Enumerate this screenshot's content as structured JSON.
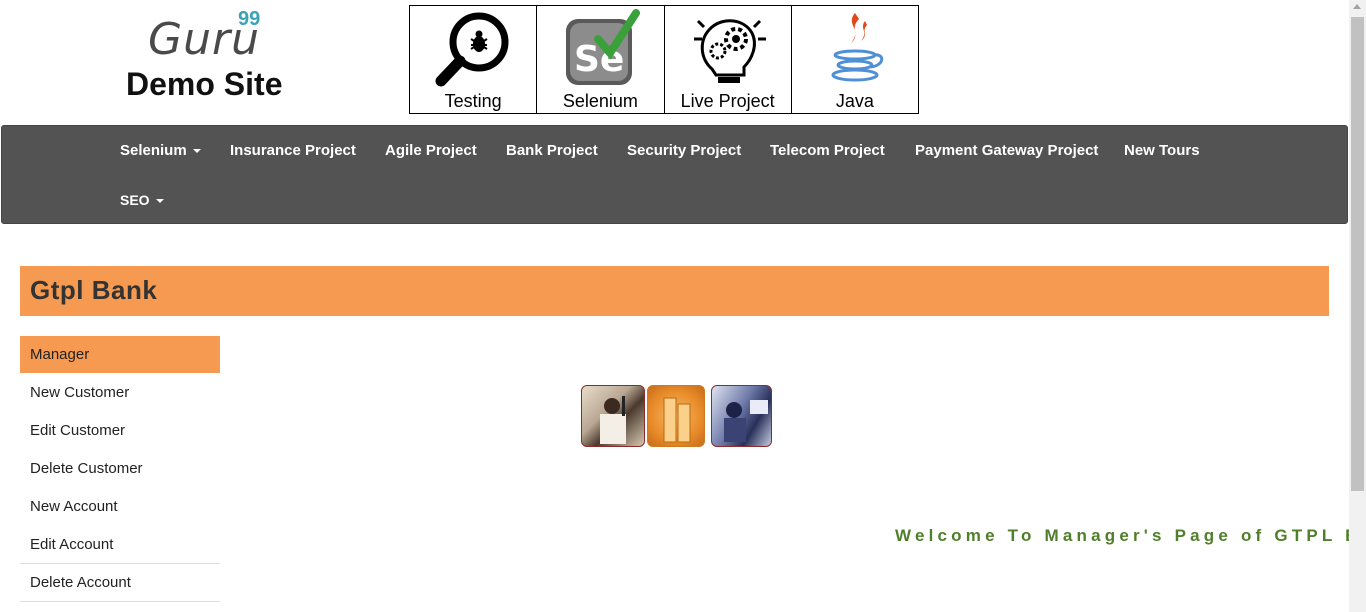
{
  "logo": {
    "brand": "Guru",
    "superscript": "99",
    "subtitle": "Demo Site"
  },
  "tiles": [
    {
      "label": "Testing",
      "icon": "magnifier-bug-icon"
    },
    {
      "label": "Selenium",
      "icon": "selenium-logo-icon"
    },
    {
      "label": "Live Project",
      "icon": "lightbulb-gear-icon"
    },
    {
      "label": "Java",
      "icon": "java-cup-icon"
    }
  ],
  "nav": {
    "selenium": "Selenium",
    "insurance": "Insurance Project",
    "agile": "Agile Project",
    "bank": "Bank Project",
    "security": "Security Project",
    "telecom": "Telecom Project",
    "payment": "Payment Gateway Project",
    "tours": "New Tours",
    "seo": "SEO"
  },
  "bank": {
    "title": "Gtpl Bank"
  },
  "sidebar": {
    "items": [
      {
        "label": "Manager"
      },
      {
        "label": "New Customer"
      },
      {
        "label": "Edit Customer"
      },
      {
        "label": "Delete Customer"
      },
      {
        "label": "New Account"
      },
      {
        "label": "Edit Account"
      },
      {
        "label": "Delete Account"
      }
    ]
  },
  "welcome": {
    "text": "Welcome To Manager's Page of GTPL Ba"
  },
  "colors": {
    "accent": "#f79a51",
    "nav_bg": "#535353",
    "welcome": "#4f7f2a"
  }
}
